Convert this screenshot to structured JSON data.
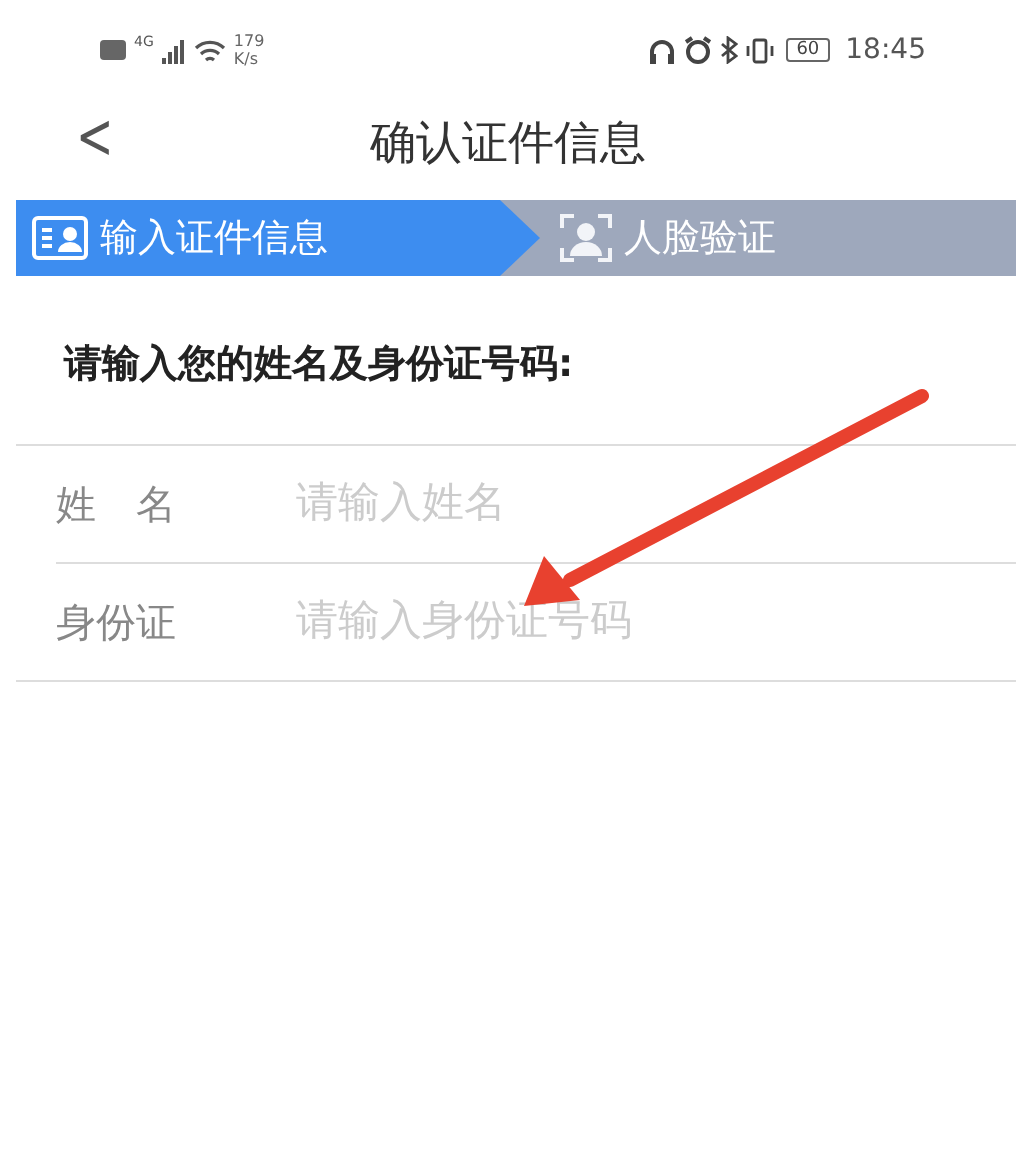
{
  "status_bar": {
    "network_type": "4G",
    "speed_value": "179",
    "speed_unit": "K/s",
    "battery": "60",
    "time": "18:45"
  },
  "header": {
    "back": "<",
    "title": "确认证件信息"
  },
  "steps": [
    {
      "label": "输入证件信息",
      "selected": true,
      "kind": "card"
    },
    {
      "label": "人脸验证",
      "selected": false,
      "kind": "face"
    }
  ],
  "prompt": "请输入您的姓名及身份证号码:",
  "fields": [
    {
      "label": "姓　名",
      "placeholder": "请输入姓名"
    },
    {
      "label": "身份证",
      "placeholder": "请输入身份证号码"
    }
  ],
  "annotation": {
    "kind": "arrow",
    "color": "#e8412f"
  }
}
